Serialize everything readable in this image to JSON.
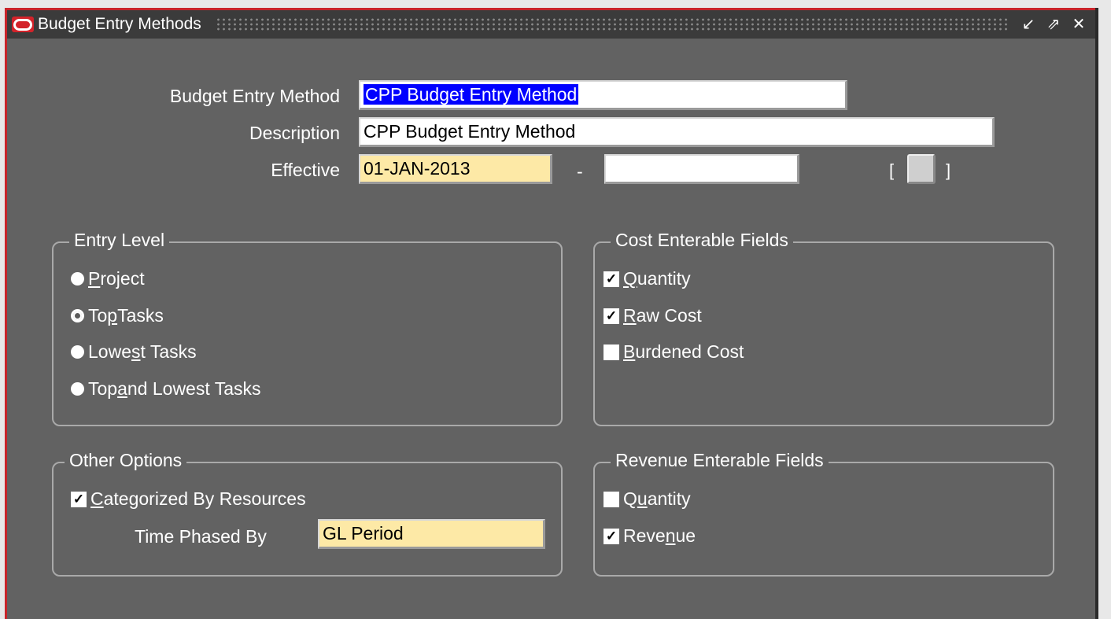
{
  "window": {
    "title": "Budget Entry Methods"
  },
  "header": {
    "budget_entry_method": {
      "label": "Budget Entry Method",
      "value": "CPP Budget Entry Method"
    },
    "description": {
      "label": "Description",
      "value": "CPP Budget Entry Method"
    },
    "effective": {
      "label": "Effective",
      "from": "01-JAN-2013",
      "to": "",
      "separator": "-",
      "bracket_open": "[",
      "bracket_close": "]"
    }
  },
  "entry_level": {
    "title": "Entry Level",
    "options": [
      {
        "pre": "",
        "key": "P",
        "post": "roject",
        "selected": false
      },
      {
        "pre": "To",
        "key": "p",
        "post": " Tasks",
        "selected": true
      },
      {
        "pre": "Lowe",
        "key": "s",
        "post": "t Tasks",
        "selected": false
      },
      {
        "pre": "Top ",
        "key": "a",
        "post": "nd Lowest Tasks",
        "selected": false
      }
    ]
  },
  "cost_fields": {
    "title": "Cost Enterable Fields",
    "items": [
      {
        "pre": "",
        "key": "Q",
        "post": "uantity",
        "checked": true
      },
      {
        "pre": "",
        "key": "R",
        "post": "aw Cost",
        "checked": true
      },
      {
        "pre": "",
        "key": "B",
        "post": "urdened Cost",
        "checked": false
      }
    ]
  },
  "other_options": {
    "title": "Other Options",
    "categorized": {
      "pre": "",
      "key": "C",
      "post": "ategorized By Resources",
      "checked": true
    },
    "time_phased": {
      "label": "Time Phased By",
      "value": "GL Period"
    }
  },
  "revenue_fields": {
    "title": "Revenue Enterable Fields",
    "items": [
      {
        "pre": "Q",
        "key": "u",
        "post": "antity",
        "checked": false
      },
      {
        "pre": "Reve",
        "key": "n",
        "post": "ue",
        "checked": true
      }
    ]
  },
  "colors": {
    "window_bg": "#626262",
    "title_bar": "#3b3b3b",
    "accent_red": "#c8242a",
    "required_field": "#fde9a6",
    "selection": "#0000ff"
  },
  "icons": {
    "logo": "oracle-logo-icon",
    "minimize": "minimize-icon",
    "maximize": "maximize-icon",
    "close": "close-icon"
  }
}
